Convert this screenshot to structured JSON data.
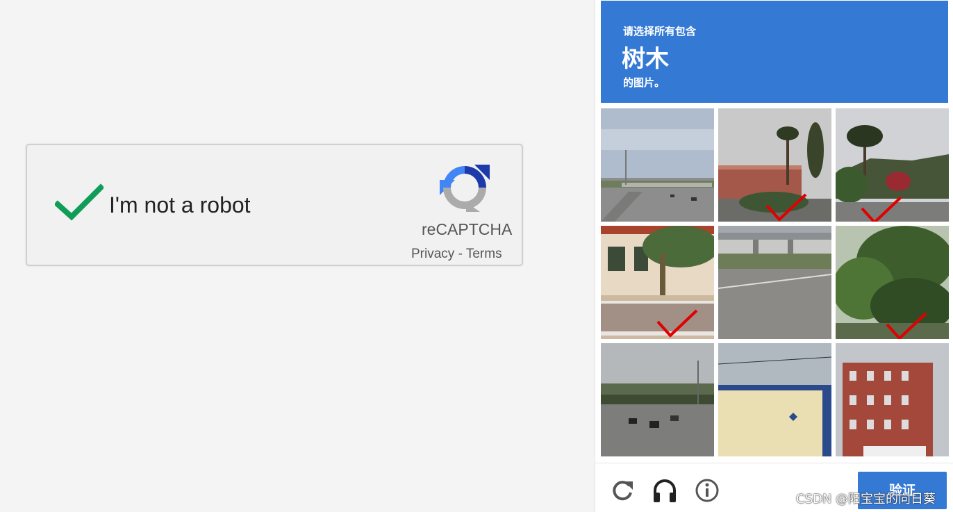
{
  "checkbox_widget": {
    "label": "I'm not a robot",
    "checked": true,
    "brand": "reCAPTCHA",
    "privacy": "Privacy",
    "separator": " - ",
    "terms": "Terms",
    "check_color": "#0f9d58"
  },
  "challenge": {
    "instruction_line1": "请选择所有包含",
    "target": "树木",
    "instruction_line3": "的图片。",
    "header_color": "#3479d4",
    "tiles": [
      {
        "scene": "highway-overpass",
        "selected": false
      },
      {
        "scene": "palm-trees-building",
        "selected": true
      },
      {
        "scene": "palm-tree-hills",
        "selected": true
      },
      {
        "scene": "house-palm",
        "selected": true
      },
      {
        "scene": "road-overpass",
        "selected": false
      },
      {
        "scene": "green-trees",
        "selected": true
      },
      {
        "scene": "freeway-bridge",
        "selected": false
      },
      {
        "scene": "commercial-building",
        "selected": false
      },
      {
        "scene": "brick-apartment",
        "selected": false
      }
    ],
    "footer": {
      "reload_icon": "reload-icon",
      "audio_icon": "headphones-icon",
      "info_icon": "info-icon",
      "verify_label": "验证"
    }
  },
  "watermark": "CSDN @阳宝宝的向日葵"
}
